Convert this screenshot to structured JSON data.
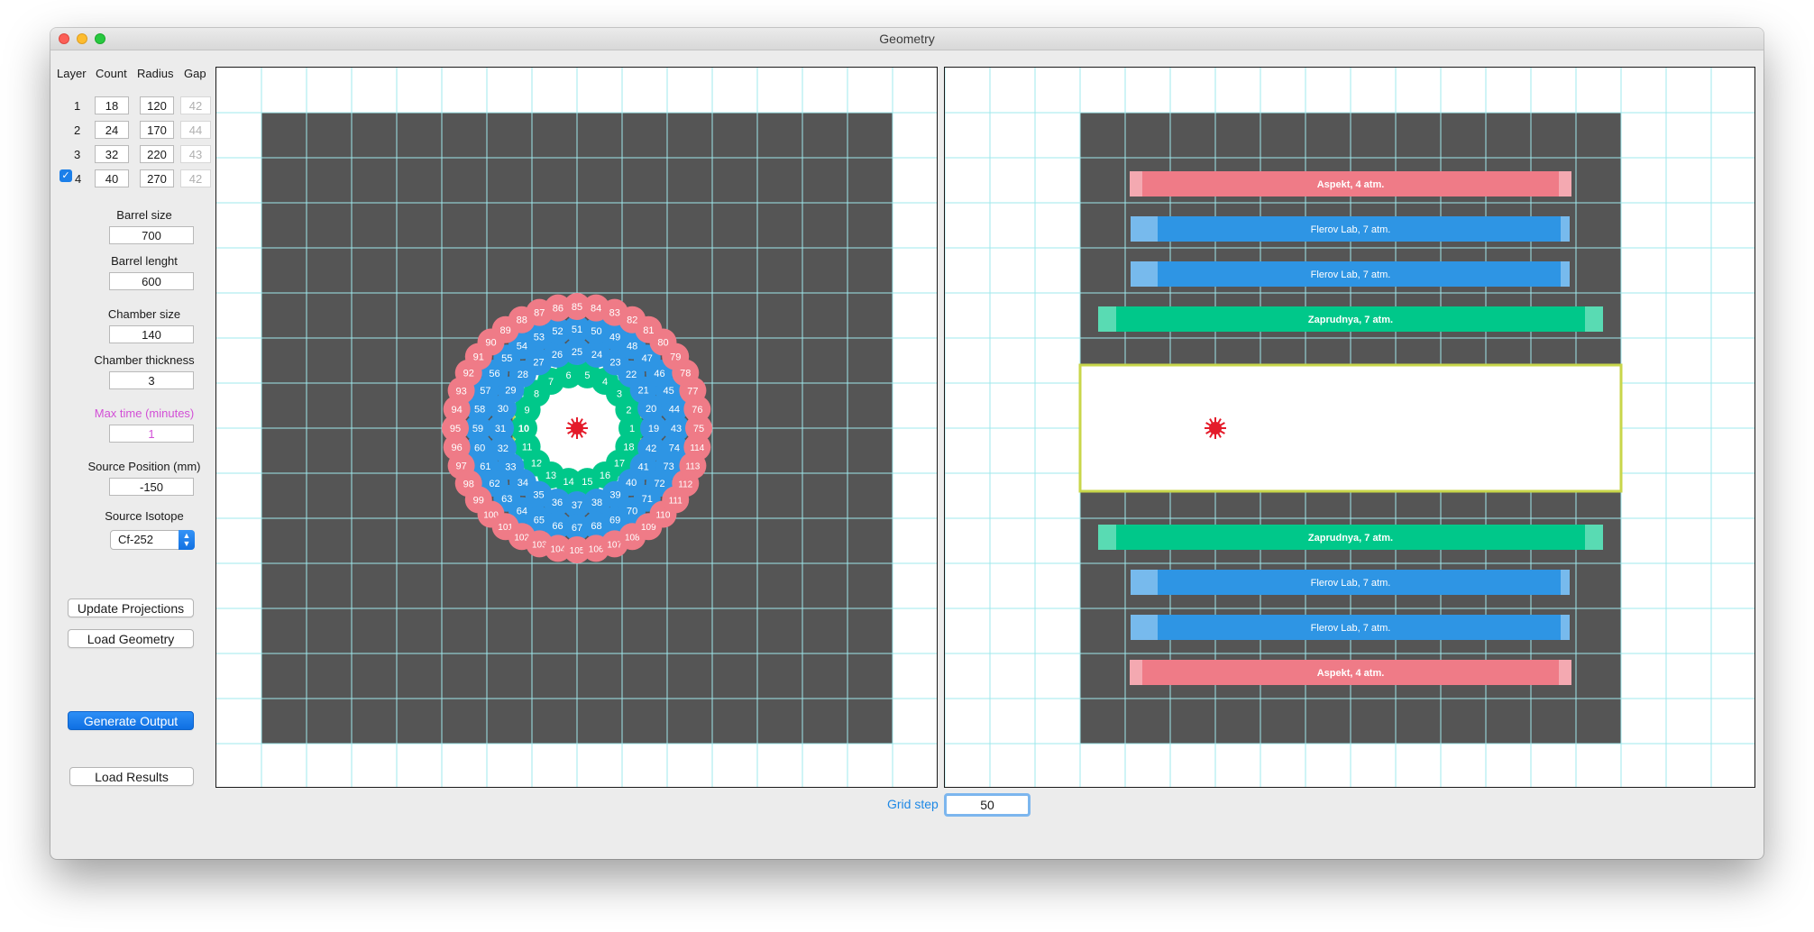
{
  "window": {
    "title": "Geometry"
  },
  "layers_table": {
    "headers": {
      "layer": "Layer",
      "count": "Count",
      "radius": "Radius",
      "gap": "Gap"
    },
    "rows": [
      {
        "layer": "1",
        "count": "18",
        "radius": "120",
        "gap": "42",
        "checked": false
      },
      {
        "layer": "2",
        "count": "24",
        "radius": "170",
        "gap": "44",
        "checked": false
      },
      {
        "layer": "3",
        "count": "32",
        "radius": "220",
        "gap": "43",
        "checked": false
      },
      {
        "layer": "4",
        "count": "40",
        "radius": "270",
        "gap": "42",
        "checked": true
      }
    ]
  },
  "form": {
    "barrel_size": {
      "label": "Barrel size",
      "value": "700"
    },
    "barrel_length": {
      "label": "Barrel lenght",
      "value": "600"
    },
    "chamber_size": {
      "label": "Chamber size",
      "value": "140"
    },
    "chamber_thickness": {
      "label": "Chamber thickness",
      "value": "3"
    },
    "max_time": {
      "label": "Max time (minutes)",
      "value": "1"
    },
    "source_position": {
      "label": "Source Position (mm)",
      "value": "-150"
    },
    "source_isotope": {
      "label": "Source Isotope",
      "value": "Cf-252"
    }
  },
  "buttons": {
    "update_projections": "Update Projections",
    "load_geometry": "Load Geometry",
    "generate_output": "Generate Output",
    "load_results": "Load Results"
  },
  "grid_step": {
    "label": "Grid step",
    "value": "50"
  },
  "colors": {
    "layer1": "#00c88a",
    "layer2": "#2e95e4",
    "layer3": "#2e95e4",
    "layer4": "#ef7b87",
    "background": "#555555",
    "chamber": "#c8d64a",
    "source": "#e41b2a",
    "grid": "#9fe8ec",
    "accent": "#1b7fe9",
    "magenta_label": "#d24fd6"
  },
  "side_view": {
    "bars": [
      {
        "label": "Aspekt, 4 atm.",
        "color": "#ef7b87"
      },
      {
        "label": "Flerov Lab, 7 atm.",
        "color": "#2e95e4"
      },
      {
        "label": "Flerov Lab, 7 atm.",
        "color": "#2e95e4"
      },
      {
        "label": "Zaprudnya, 7 atm.",
        "color": "#00c88a"
      },
      {
        "label": "Zaprudnya, 7 atm.",
        "color": "#00c88a"
      },
      {
        "label": "Flerov Lab, 7 atm.",
        "color": "#2e95e4"
      },
      {
        "label": "Flerov Lab, 7 atm.",
        "color": "#2e95e4"
      },
      {
        "label": "Aspekt, 4 atm.",
        "color": "#ef7b87"
      }
    ]
  }
}
